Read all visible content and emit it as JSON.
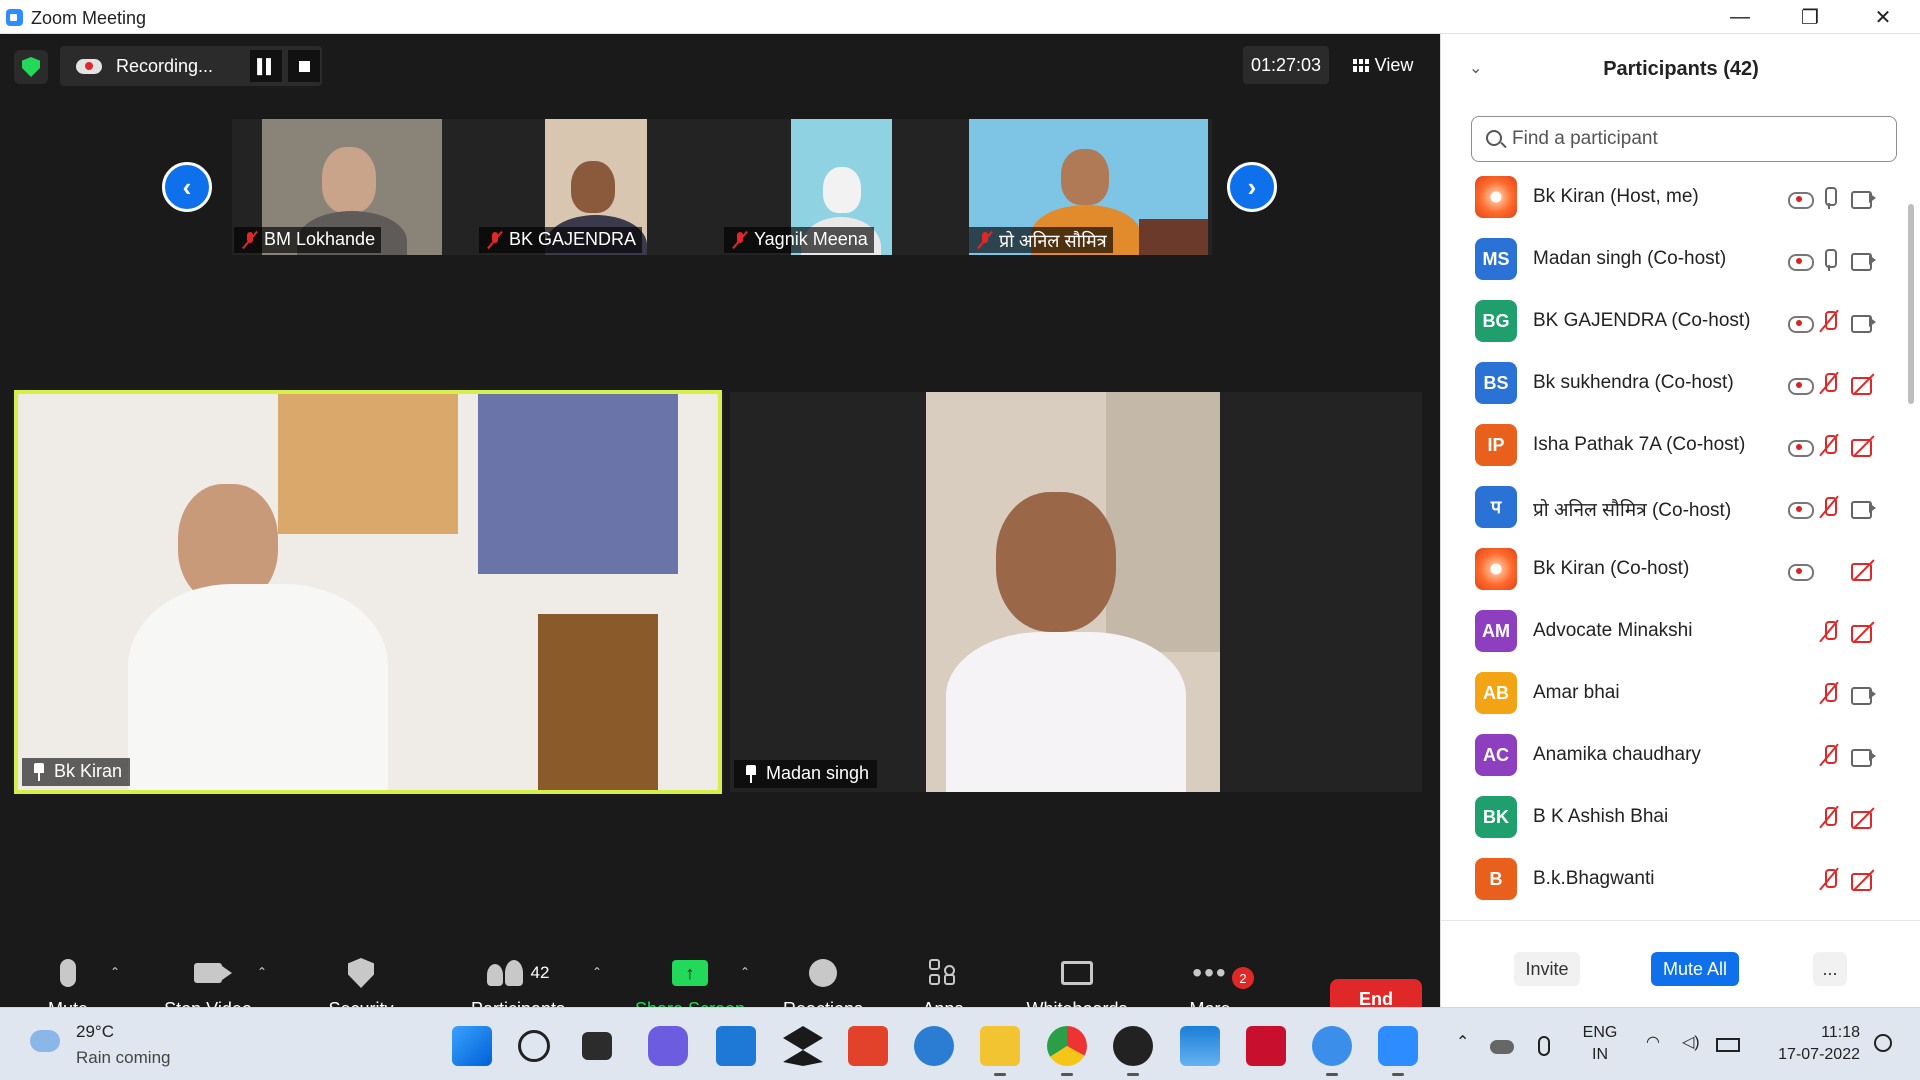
{
  "window": {
    "title": "Zoom Meeting"
  },
  "recording": {
    "label": "Recording..."
  },
  "timer": "01:27:03",
  "view_label": "View",
  "thumbnails": [
    {
      "name": "BM Lokhande"
    },
    {
      "name": "BK GAJENDRA"
    },
    {
      "name": "Yagnik Meena"
    },
    {
      "name": "प्रो अनिल सौमित्र"
    }
  ],
  "tiles": [
    {
      "name": "Bk Kiran",
      "active_speaker": true
    },
    {
      "name": "Madan singh",
      "active_speaker": false
    }
  ],
  "toolbar": {
    "mute": "Mute",
    "stop_video": "Stop Video",
    "security": "Security",
    "participants": "Participants",
    "participants_count": "42",
    "share_screen": "Share Screen",
    "reactions": "Reactions",
    "apps": "Apps",
    "whiteboards": "Whiteboards",
    "more": "More",
    "more_badge": "2",
    "end": "End"
  },
  "panel": {
    "title": "Participants (42)",
    "search_placeholder": "Find a participant",
    "participants": [
      {
        "initials": "",
        "name": "Bk Kiran (Host, me)",
        "color": "#ff6a2b",
        "rec": true,
        "mic": "on",
        "cam": "on"
      },
      {
        "initials": "MS",
        "name": "Madan singh (Co-host)",
        "color": "#2b72d6",
        "rec": true,
        "mic": "on",
        "cam": "on"
      },
      {
        "initials": "BG",
        "name": "BK GAJENDRA (Co-host)",
        "color": "#1f9e6e",
        "rec": true,
        "mic": "off",
        "cam": "on"
      },
      {
        "initials": "BS",
        "name": "Bk sukhendra (Co-host)",
        "color": "#2b72d6",
        "rec": true,
        "mic": "off",
        "cam": "off"
      },
      {
        "initials": "IP",
        "name": "Isha Pathak 7A (Co-host)",
        "color": "#e8601c",
        "rec": true,
        "mic": "off",
        "cam": "off"
      },
      {
        "initials": "प",
        "name": "प्रो अनिल सौमित्र (Co-host)",
        "color": "#2b72d6",
        "rec": true,
        "mic": "off",
        "cam": "on"
      },
      {
        "initials": "",
        "name": "Bk Kiran (Co-host)",
        "color": "#ff6a2b",
        "rec": true,
        "mic": "none",
        "cam": "off"
      },
      {
        "initials": "AM",
        "name": "Advocate Minakshi",
        "color": "#8e3fbf",
        "rec": false,
        "mic": "off",
        "cam": "off"
      },
      {
        "initials": "AB",
        "name": "Amar bhai",
        "color": "#f2a414",
        "rec": false,
        "mic": "off",
        "cam": "on"
      },
      {
        "initials": "AC",
        "name": "Anamika chaudhary",
        "color": "#8e3fbf",
        "rec": false,
        "mic": "off",
        "cam": "on"
      },
      {
        "initials": "BK",
        "name": "B K Ashish Bhai",
        "color": "#1f9e6e",
        "rec": false,
        "mic": "off",
        "cam": "off"
      },
      {
        "initials": "B",
        "name": "B.k.Bhagwanti",
        "color": "#e8601c",
        "rec": false,
        "mic": "off",
        "cam": "off"
      }
    ],
    "invite": "Invite",
    "mute_all": "Mute All",
    "more": "..."
  },
  "taskbar": {
    "weather_temp": "29°C",
    "weather_desc": "Rain coming",
    "lang_top": "ENG",
    "lang_bottom": "IN",
    "time": "11:18",
    "date": "17-07-2022"
  }
}
